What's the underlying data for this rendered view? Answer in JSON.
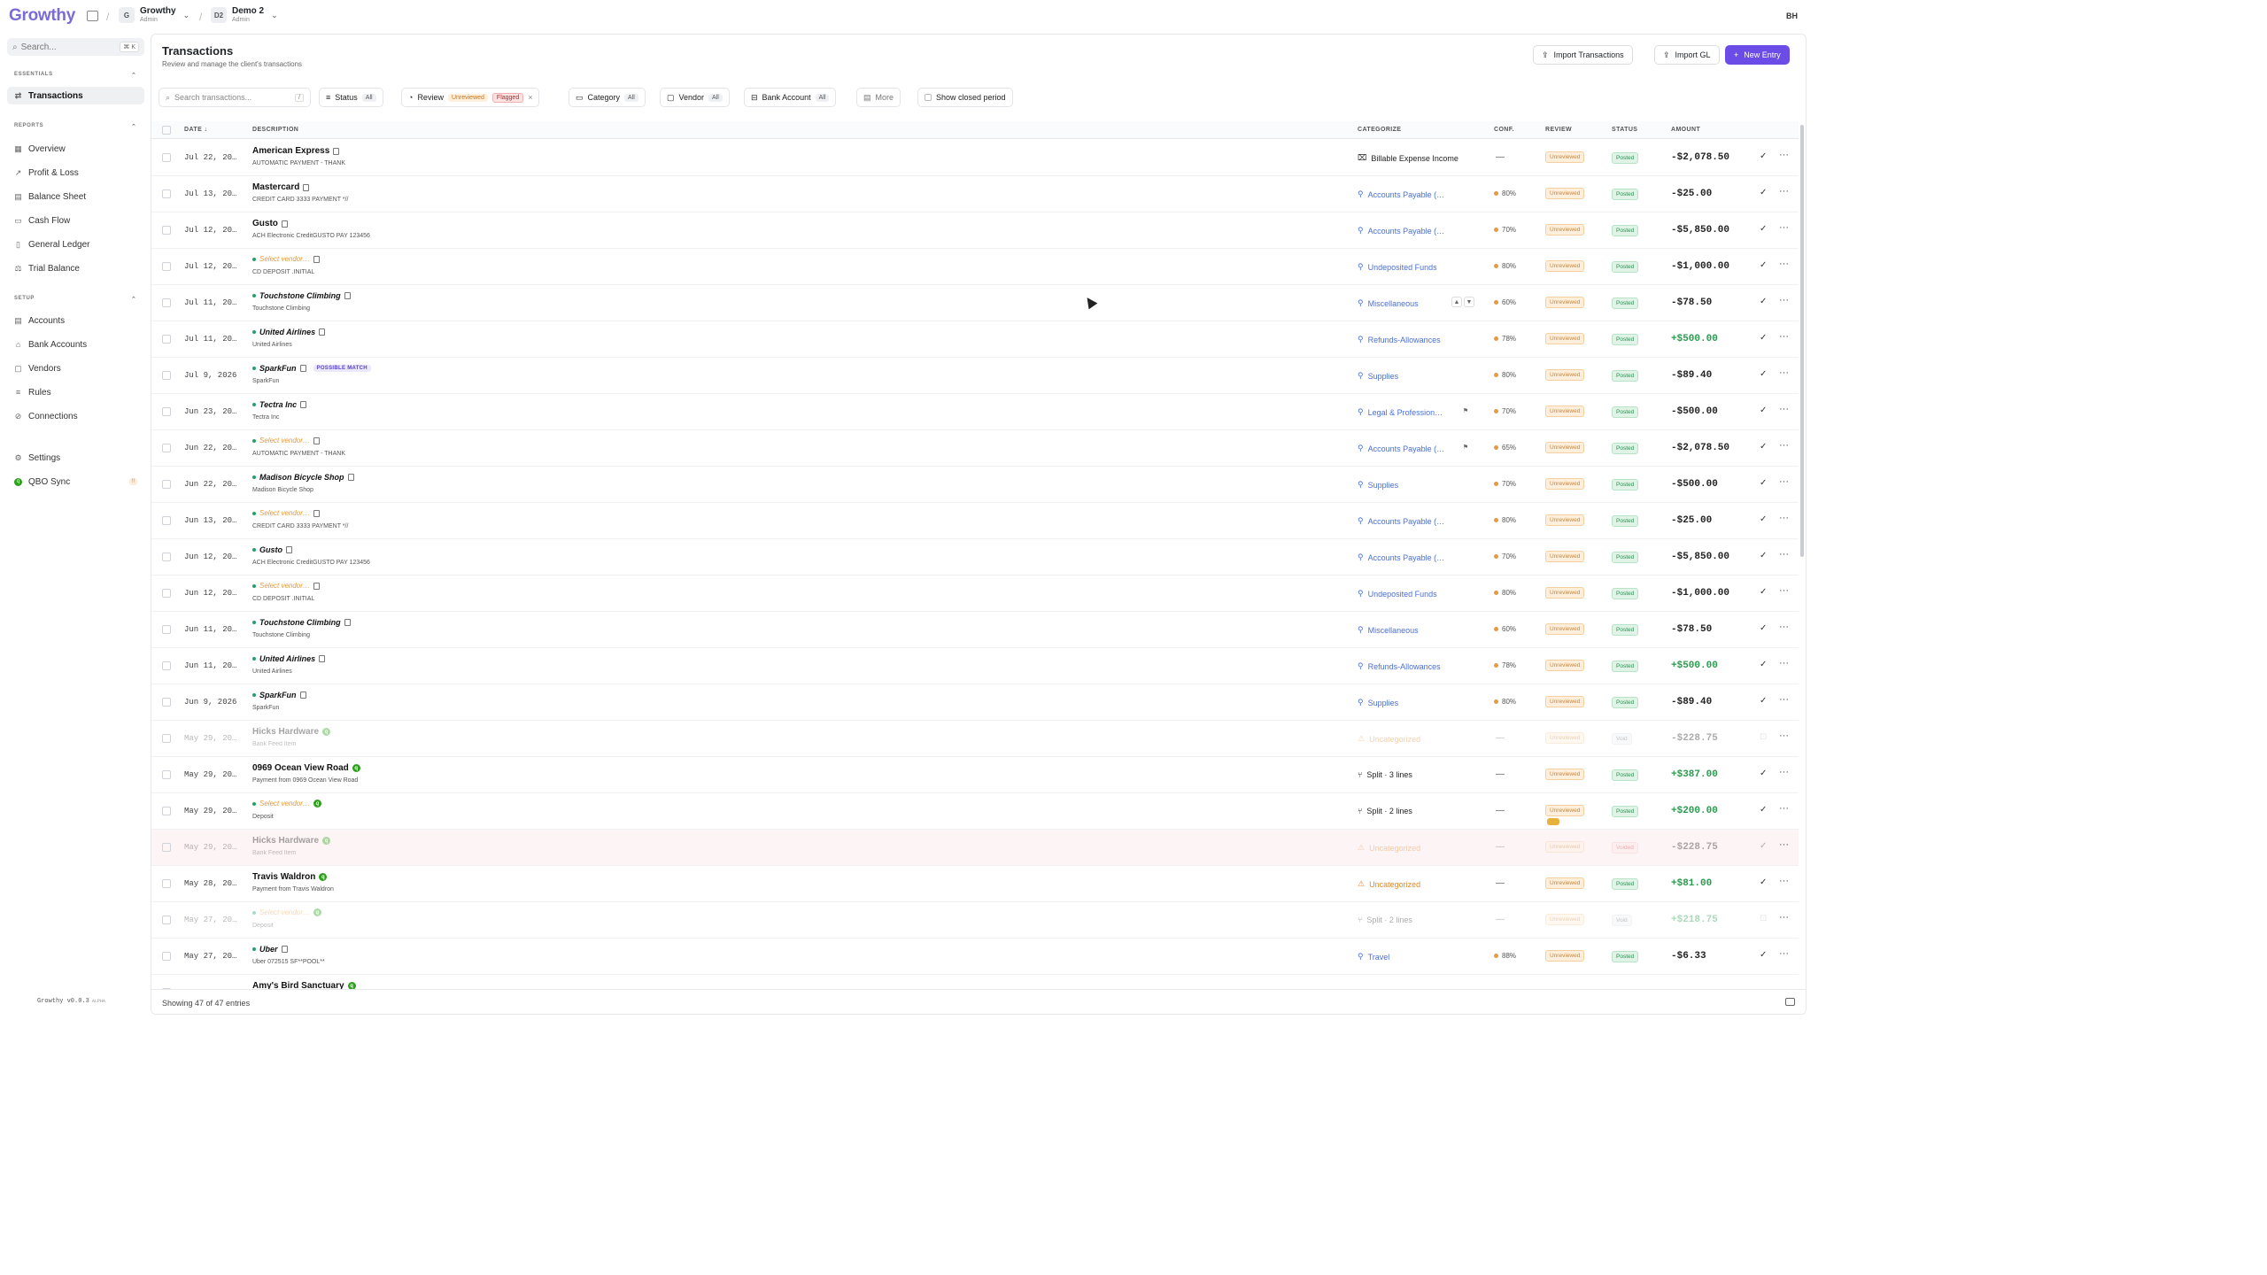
{
  "app": {
    "logo": "Growthy",
    "org_name": "Growthy",
    "org_role": "Admin",
    "org_badge": "G",
    "client_name": "Demo 2",
    "client_role": "Admin",
    "client_badge": "D2",
    "user_initials": "BH"
  },
  "sidebar": {
    "search_placeholder": "Search...",
    "search_shortcut": "⌘ K",
    "essentials_label": "ESSENTIALS",
    "reports_label": "REPORTS",
    "setup_label": "SETUP",
    "items": [
      {
        "label": "Transactions"
      },
      {
        "label": "Overview"
      },
      {
        "label": "Profit & Loss"
      },
      {
        "label": "Balance Sheet"
      },
      {
        "label": "Cash Flow"
      },
      {
        "label": "General Ledger"
      },
      {
        "label": "Trial Balance"
      },
      {
        "label": "Accounts"
      },
      {
        "label": "Bank Accounts"
      },
      {
        "label": "Vendors"
      },
      {
        "label": "Rules"
      },
      {
        "label": "Connections"
      },
      {
        "label": "Settings"
      },
      {
        "label": "QBO Sync",
        "badge": "!!"
      }
    ],
    "version": "Growthy v0.0.3",
    "version_tag": "ALPHA"
  },
  "page": {
    "title": "Transactions",
    "subtitle": "Review and manage the client's transactions"
  },
  "actions": {
    "import_transactions": "Import Transactions",
    "import_gl": "Import GL",
    "new_entry": "New Entry"
  },
  "filters": {
    "search_placeholder": "Search transactions...",
    "search_shortcut": "/",
    "status_label": "Status",
    "status_value": "All",
    "review_label": "Review",
    "review_unreviewed": "Unreviewed",
    "review_flagged": "Flagged",
    "category_label": "Category",
    "category_value": "All",
    "vendor_label": "Vendor",
    "vendor_value": "All",
    "bank_label": "Bank Account",
    "bank_value": "All",
    "more_label": "More",
    "closed_label": "Show closed period"
  },
  "columns": {
    "date": "DATE ↓",
    "description": "DESCRIPTION",
    "categorize": "CATEGORIZE",
    "conf": "CONF.",
    "review": "REVIEW",
    "status": "STATUS",
    "amount": "AMOUNT"
  },
  "rows": [
    {
      "date": "Jul 22, 20…",
      "vendor": "American Express",
      "memo": "AUTOMATIC PAYMENT - THANK",
      "category": "Billable Expense Income",
      "cat_style": "dark",
      "conf": "—",
      "review": "Unreviewed",
      "status": "Posted",
      "amount": "-$2,078.50"
    },
    {
      "date": "Jul 13, 20…",
      "vendor": "Mastercard",
      "memo": "CREDIT CARD 3333 PAYMENT *//",
      "category": "Accounts Payable (…",
      "conf": "80%",
      "review": "Unreviewed",
      "status": "Posted",
      "amount": "-$25.00"
    },
    {
      "date": "Jul 12, 20…",
      "vendor": "Gusto",
      "memo": "ACH Electronic CreditGUSTO PAY 123456",
      "category": "Accounts Payable (…",
      "conf": "70%",
      "review": "Unreviewed",
      "status": "Posted",
      "amount": "-$5,850.00"
    },
    {
      "date": "Jul 12, 20…",
      "vendor": "Select vendor…",
      "memo": "CD DEPOSIT .INITIAL",
      "category": "Undeposited Funds",
      "conf": "80%",
      "review": "Unreviewed",
      "status": "Posted",
      "amount": "-$1,000.00"
    },
    {
      "date": "Jul 11, 20…",
      "vendor": "Touchstone Climbing",
      "memo": "Touchstone Climbing",
      "category": "Miscellaneous",
      "conf": "60%",
      "review": "Unreviewed",
      "status": "Posted",
      "amount": "-$78.50"
    },
    {
      "date": "Jul 11, 20…",
      "vendor": "United Airlines",
      "memo": "United Airlines",
      "category": "Refunds-Allowances",
      "conf": "78%",
      "review": "Unreviewed",
      "status": "Posted",
      "amount": "+$500.00"
    },
    {
      "date": "Jul 9, 2026",
      "vendor": "SparkFun",
      "memo": "SparkFun",
      "category": "Supplies",
      "conf": "80%",
      "review": "Unreviewed",
      "status": "Posted",
      "amount": "-$89.40",
      "tag": "POSSIBLE MATCH"
    },
    {
      "date": "Jun 23, 20…",
      "vendor": "Tectra Inc",
      "memo": "Tectra Inc",
      "category": "Legal & Profession…",
      "conf": "70%",
      "review": "Unreviewed",
      "status": "Posted",
      "amount": "-$500.00"
    },
    {
      "date": "Jun 22, 20…",
      "vendor": "Select vendor…",
      "memo": "AUTOMATIC PAYMENT - THANK",
      "category": "Accounts Payable (…",
      "conf": "65%",
      "review": "Unreviewed",
      "status": "Posted",
      "amount": "-$2,078.50"
    },
    {
      "date": "Jun 22, 20…",
      "vendor": "Madison Bicycle Shop",
      "memo": "Madison Bicycle Shop",
      "category": "Supplies",
      "conf": "70%",
      "review": "Unreviewed",
      "status": "Posted",
      "amount": "-$500.00"
    },
    {
      "date": "Jun 13, 20…",
      "vendor": "Select vendor…",
      "memo": "CREDIT CARD 3333 PAYMENT *//",
      "category": "Accounts Payable (…",
      "conf": "80%",
      "review": "Unreviewed",
      "status": "Posted",
      "amount": "-$25.00"
    },
    {
      "date": "Jun 12, 20…",
      "vendor": "Gusto",
      "memo": "ACH Electronic CreditGUSTO PAY 123456",
      "category": "Accounts Payable (…",
      "conf": "70%",
      "review": "Unreviewed",
      "status": "Posted",
      "amount": "-$5,850.00"
    },
    {
      "date": "Jun 12, 20…",
      "vendor": "Select vendor…",
      "memo": "CD DEPOSIT .INITIAL",
      "category": "Undeposited Funds",
      "conf": "80%",
      "review": "Unreviewed",
      "status": "Posted",
      "amount": "-$1,000.00"
    },
    {
      "date": "Jun 11, 20…",
      "vendor": "Touchstone Climbing",
      "memo": "Touchstone Climbing",
      "category": "Miscellaneous",
      "conf": "60%",
      "review": "Unreviewed",
      "status": "Posted",
      "amount": "-$78.50"
    },
    {
      "date": "Jun 11, 20…",
      "vendor": "United Airlines",
      "memo": "United Airlines",
      "category": "Refunds-Allowances",
      "conf": "78%",
      "review": "Unreviewed",
      "status": "Posted",
      "amount": "+$500.00"
    },
    {
      "date": "Jun 9, 2026",
      "vendor": "SparkFun",
      "memo": "SparkFun",
      "category": "Supplies",
      "conf": "80%",
      "review": "Unreviewed",
      "status": "Posted",
      "amount": "-$89.40"
    },
    {
      "date": "May 29, 20…",
      "vendor": "Hicks Hardware",
      "memo": "Bank Feed Item",
      "category": "Uncategorized",
      "cat_style": "warn",
      "conf": "—",
      "review": "Unreviewed",
      "status": "Void",
      "amount": "-$228.75",
      "dim": true
    },
    {
      "date": "May 29, 20…",
      "vendor": "0969 Ocean View Road",
      "memo": "Payment from 0969 Ocean View Road",
      "category": "Split · 3 lines",
      "cat_style": "dark",
      "conf": "—",
      "review": "Unreviewed",
      "status": "Posted",
      "amount": "+$387.00"
    },
    {
      "date": "May 29, 20…",
      "vendor": "Select vendor…",
      "memo": "Deposit",
      "category": "Split · 2 lines",
      "cat_style": "dark",
      "conf": "—",
      "review": "Unreviewed",
      "status": "Posted",
      "amount": "+$200.00"
    },
    {
      "date": "May 29, 20…",
      "vendor": "Hicks Hardware",
      "memo": "Bank Feed Item",
      "category": "Uncategorized",
      "cat_style": "warn",
      "conf": "—",
      "review": "Unreviewed",
      "status": "Voided",
      "amount": "-$228.75",
      "dim": true,
      "pink": true
    },
    {
      "date": "May 28, 20…",
      "vendor": "Travis Waldron",
      "memo": "Payment from Travis Waldron",
      "category": "Uncategorized",
      "cat_style": "warn",
      "conf": "—",
      "review": "Unreviewed",
      "status": "Posted",
      "amount": "+$81.00"
    },
    {
      "date": "May 27, 20…",
      "vendor": "Select vendor…",
      "memo": "Deposit",
      "category": "Split · 2 lines",
      "cat_style": "dark",
      "conf": "—",
      "review": "Unreviewed",
      "status": "Void",
      "amount": "+$218.75",
      "dim": true
    },
    {
      "date": "May 27, 20…",
      "vendor": "Uber",
      "memo": "Uber 072515 SF**POOL**",
      "category": "Travel",
      "conf": "88%",
      "review": "Unreviewed",
      "status": "Posted",
      "amount": "-$6.33"
    },
    {
      "date": "",
      "vendor": "Amy's Bird Sanctuary",
      "memo": "",
      "category": "",
      "conf": "",
      "review": "",
      "status": "",
      "amount": ""
    }
  ],
  "footer": {
    "showing": "Showing 47 of 47 entries"
  }
}
